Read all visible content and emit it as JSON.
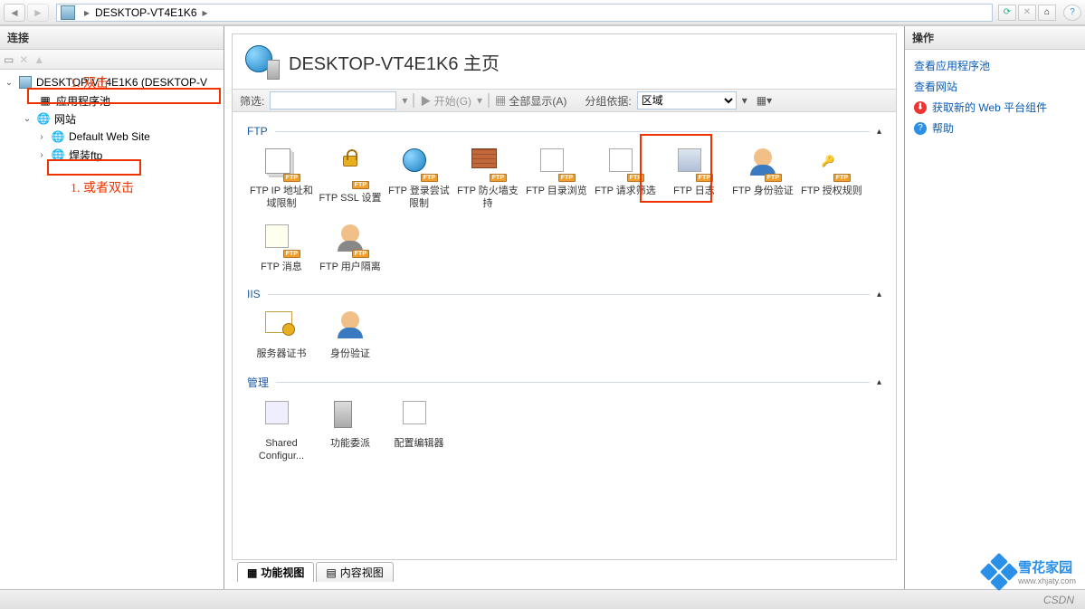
{
  "breadcrumb": {
    "host": "DESKTOP-VT4E1K6"
  },
  "left": {
    "header": "连接",
    "root_label": "DESKTOP-VT4E1K6 (DESKTOP-V",
    "app_pool": "应用程序池",
    "sites": "网站",
    "default_site": "Default Web Site",
    "ftp_site": "焊装ftp"
  },
  "annot": {
    "a1": "1. 双击",
    "a2": "1. 或者双击"
  },
  "page": {
    "title": "DESKTOP-VT4E1K6 主页",
    "filter_label": "筛选:",
    "go_label": "开始(G)",
    "showall_label": "全部显示(A)",
    "groupby_label": "分组依据:",
    "groupby_value": "区域"
  },
  "groups": {
    "ftp": "FTP",
    "iis": "IIS",
    "mgmt": "管理"
  },
  "feat": {
    "ftp_ip": "FTP IP 地址和域限制",
    "ftp_ssl": "FTP SSL 设置",
    "ftp_login": "FTP 登录尝试限制",
    "ftp_firewall": "FTP 防火墙支持",
    "ftp_browse": "FTP 目录浏览",
    "ftp_filter": "FTP 请求筛选",
    "ftp_log": "FTP 日志",
    "ftp_auth": "FTP 身份验证",
    "ftp_authz": "FTP 授权规则",
    "ftp_msg": "FTP 消息",
    "ftp_iso": "FTP 用户隔离",
    "iis_cert": "服务器证书",
    "iis_auth": "身份验证",
    "mgmt_shared": "Shared Configur...",
    "mgmt_deleg": "功能委派",
    "mgmt_cfg": "配置编辑器"
  },
  "tabs": {
    "features": "功能视图",
    "content": "内容视图"
  },
  "right": {
    "header": "操作",
    "view_pool": "查看应用程序池",
    "view_sites": "查看网站",
    "get_platform": "获取新的 Web 平台组件",
    "help": "帮助"
  },
  "watermark": {
    "title": "雪花家园",
    "url": "www.xhjaty.com"
  },
  "status": "CSDN"
}
